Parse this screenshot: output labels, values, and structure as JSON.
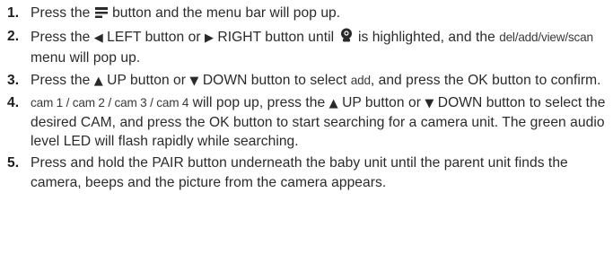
{
  "steps": [
    {
      "num": "1.",
      "a": "Press the ",
      "icon": "menu-icon",
      "b": " button and the menu bar will pop up."
    },
    {
      "num": "2.",
      "a": "Press the ",
      "left_arrow": "◀",
      "b": " LEFT button or ",
      "right_arrow": "▶",
      "c": " RIGHT button until ",
      "icon": "camera-icon",
      "d": " is highlighted, and the ",
      "menu_list": "del/add/view/scan",
      "e": " menu will pop up."
    },
    {
      "num": "3.",
      "a": "Press the ",
      "up_arrow": "▲",
      "b": " UP button or ",
      "down_arrow": "▼",
      "c": " DOWN button to select ",
      "add": "add",
      "d": ", and press the OK button to confirm."
    },
    {
      "num": "4.",
      "cams": "cam 1 / cam 2 / cam 3 / cam 4",
      "a": " will pop up, press the ",
      "up_arrow": "▲",
      "b": " UP button or ",
      "down_arrow": "▼",
      "c": " DOWN button to select the desired CAM, and press the OK button to start searching for a camera unit. The green audio level LED will flash rapidly while searching."
    },
    {
      "num": "5.",
      "a": "Press and hold the PAIR button underneath the baby unit until the parent unit finds the camera, beeps and the picture from the camera appears."
    }
  ]
}
